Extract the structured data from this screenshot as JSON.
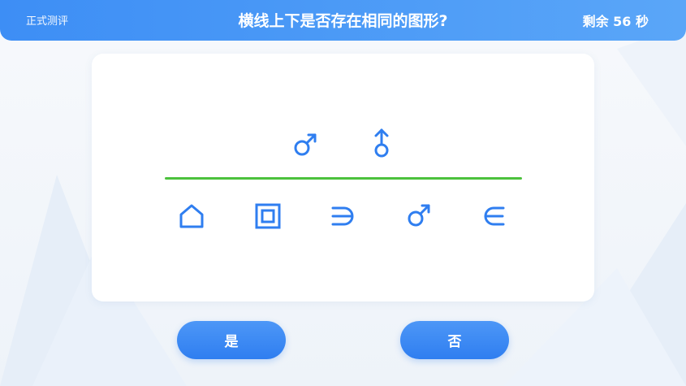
{
  "header": {
    "mode_label": "正式测评",
    "title": "横线上下是否存在相同的图形?",
    "timer": "剩余 56 秒"
  },
  "question": {
    "top_symbols": [
      "male-icon",
      "male-up-icon"
    ],
    "bottom_symbols": [
      "house-icon",
      "square-frame-icon",
      "superset-icon",
      "male-icon",
      "element-of-icon"
    ],
    "symbol_color": "#2f7ef0",
    "divider_color": "#4cc13d"
  },
  "answers": {
    "yes_label": "是",
    "no_label": "否"
  },
  "colors": {
    "header_start": "#3d8ef5",
    "header_end": "#5aa6f8",
    "button": "#2f7ef0"
  }
}
